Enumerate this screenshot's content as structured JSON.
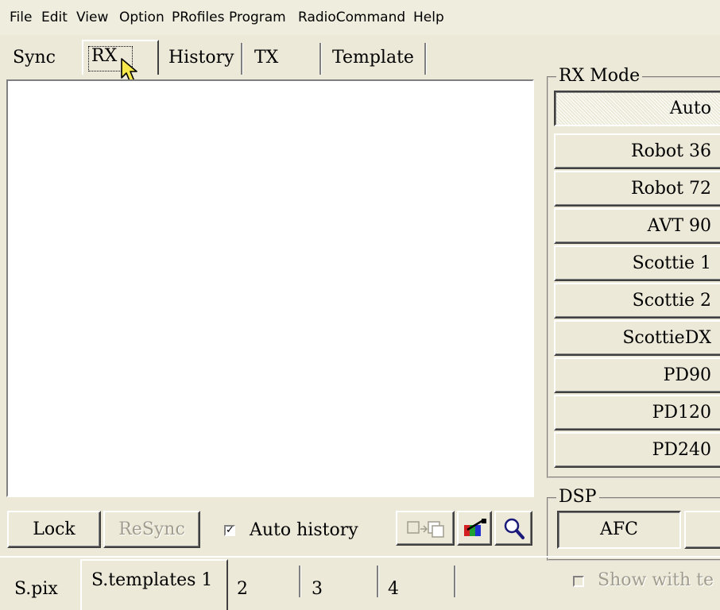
{
  "menu": [
    "File",
    "Edit",
    "View",
    "Option",
    "PRofiles",
    "Program",
    "RadioCommand",
    "Help"
  ],
  "top_tabs": [
    "Sync",
    "RX",
    "History",
    "TX",
    "Template"
  ],
  "active_tab": "RX",
  "rx_mode": {
    "title": "RX Mode",
    "buttons": [
      "Auto",
      "Robot 36",
      "Robot 72",
      "AVT 90",
      "Scottie 1",
      "Scottie 2",
      "ScottieDX",
      "PD90",
      "PD120",
      "PD240"
    ],
    "selected": "Auto"
  },
  "dsp": {
    "title": "DSP",
    "afc_label": "AFC"
  },
  "bottom_controls": {
    "lock_label": "Lock",
    "resync_label": "ReSync",
    "auto_history_label": "Auto history",
    "auto_history_checked": true
  },
  "bottom_tabs": [
    "S.pix",
    "S.templates 1",
    "2",
    "3",
    "4"
  ],
  "active_bottom_tab": "S.templates 1",
  "show_with_text": {
    "label": "Show with te",
    "checked": false,
    "enabled": false
  },
  "icons": [
    "copy-icon",
    "color-palette-icon",
    "magnifier-icon",
    "cursor-icon"
  ]
}
